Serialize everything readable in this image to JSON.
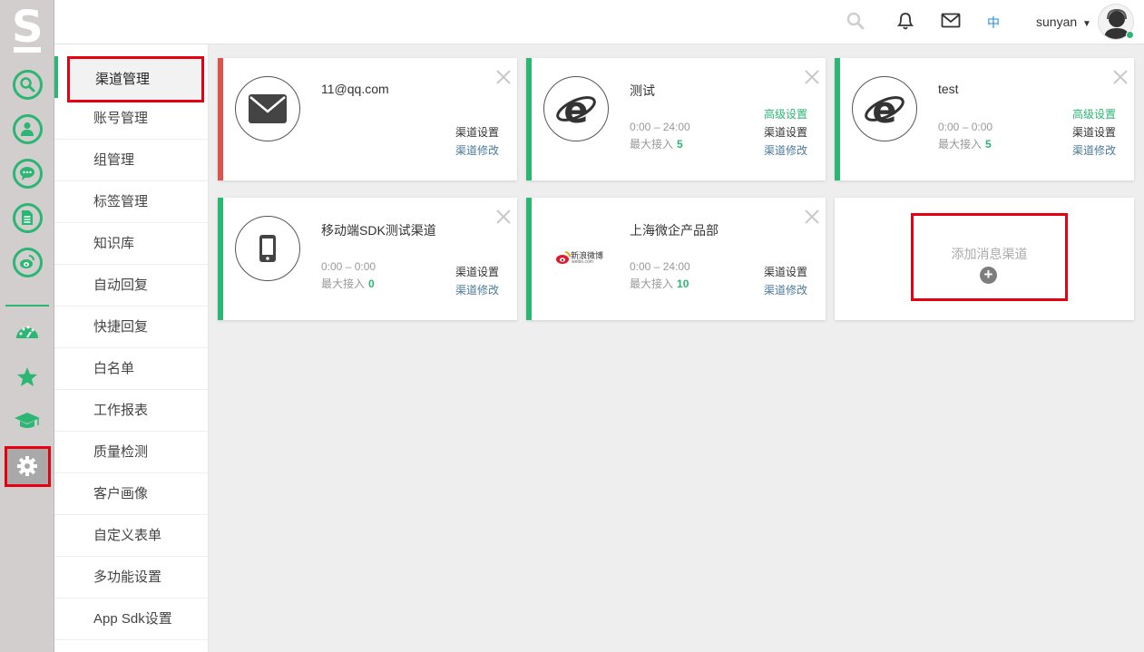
{
  "logo": "S",
  "header": {
    "language": "中",
    "username": "sunyan"
  },
  "subnav": {
    "items": [
      "渠道管理",
      "账号管理",
      "组管理",
      "标签管理",
      "知识库",
      "自动回复",
      "快捷回复",
      "白名单",
      "工作报表",
      "质量检测",
      "客户画像",
      "自定义表单",
      "多功能设置",
      "App Sdk设置"
    ]
  },
  "cards": {
    "c1": {
      "name": "11@qq.com",
      "settings": "渠道设置",
      "modify": "渠道修改"
    },
    "c2": {
      "name": "测试",
      "advanced": "高级设置",
      "settings": "渠道设置",
      "modify": "渠道修改",
      "time": "0:00 – 24:00",
      "max_label": "最大接入",
      "max_value": "5"
    },
    "c3": {
      "name": "test",
      "advanced": "高级设置",
      "settings": "渠道设置",
      "modify": "渠道修改",
      "time": "0:00 – 0:00",
      "max_label": "最大接入",
      "max_value": "5"
    },
    "c4": {
      "name": "移动端SDK测试渠道",
      "settings": "渠道设置",
      "modify": "渠道修改",
      "time": "0:00 – 0:00",
      "max_label": "最大接入",
      "max_value": "0"
    },
    "c5": {
      "name": "上海微企产品部",
      "settings": "渠道设置",
      "modify": "渠道修改",
      "time": "0:00 – 24:00",
      "max_label": "最大接入",
      "max_value": "10",
      "logo_text": "新浪微博",
      "logo_sub": "weibo.com"
    }
  },
  "add_card": {
    "label": "添加消息渠道",
    "plus": "+"
  },
  "colors": {
    "accent": "#2bb673",
    "danger_stripe": "#d9534f",
    "highlight": "#e60012",
    "link_blue": "#1f8ed8"
  }
}
